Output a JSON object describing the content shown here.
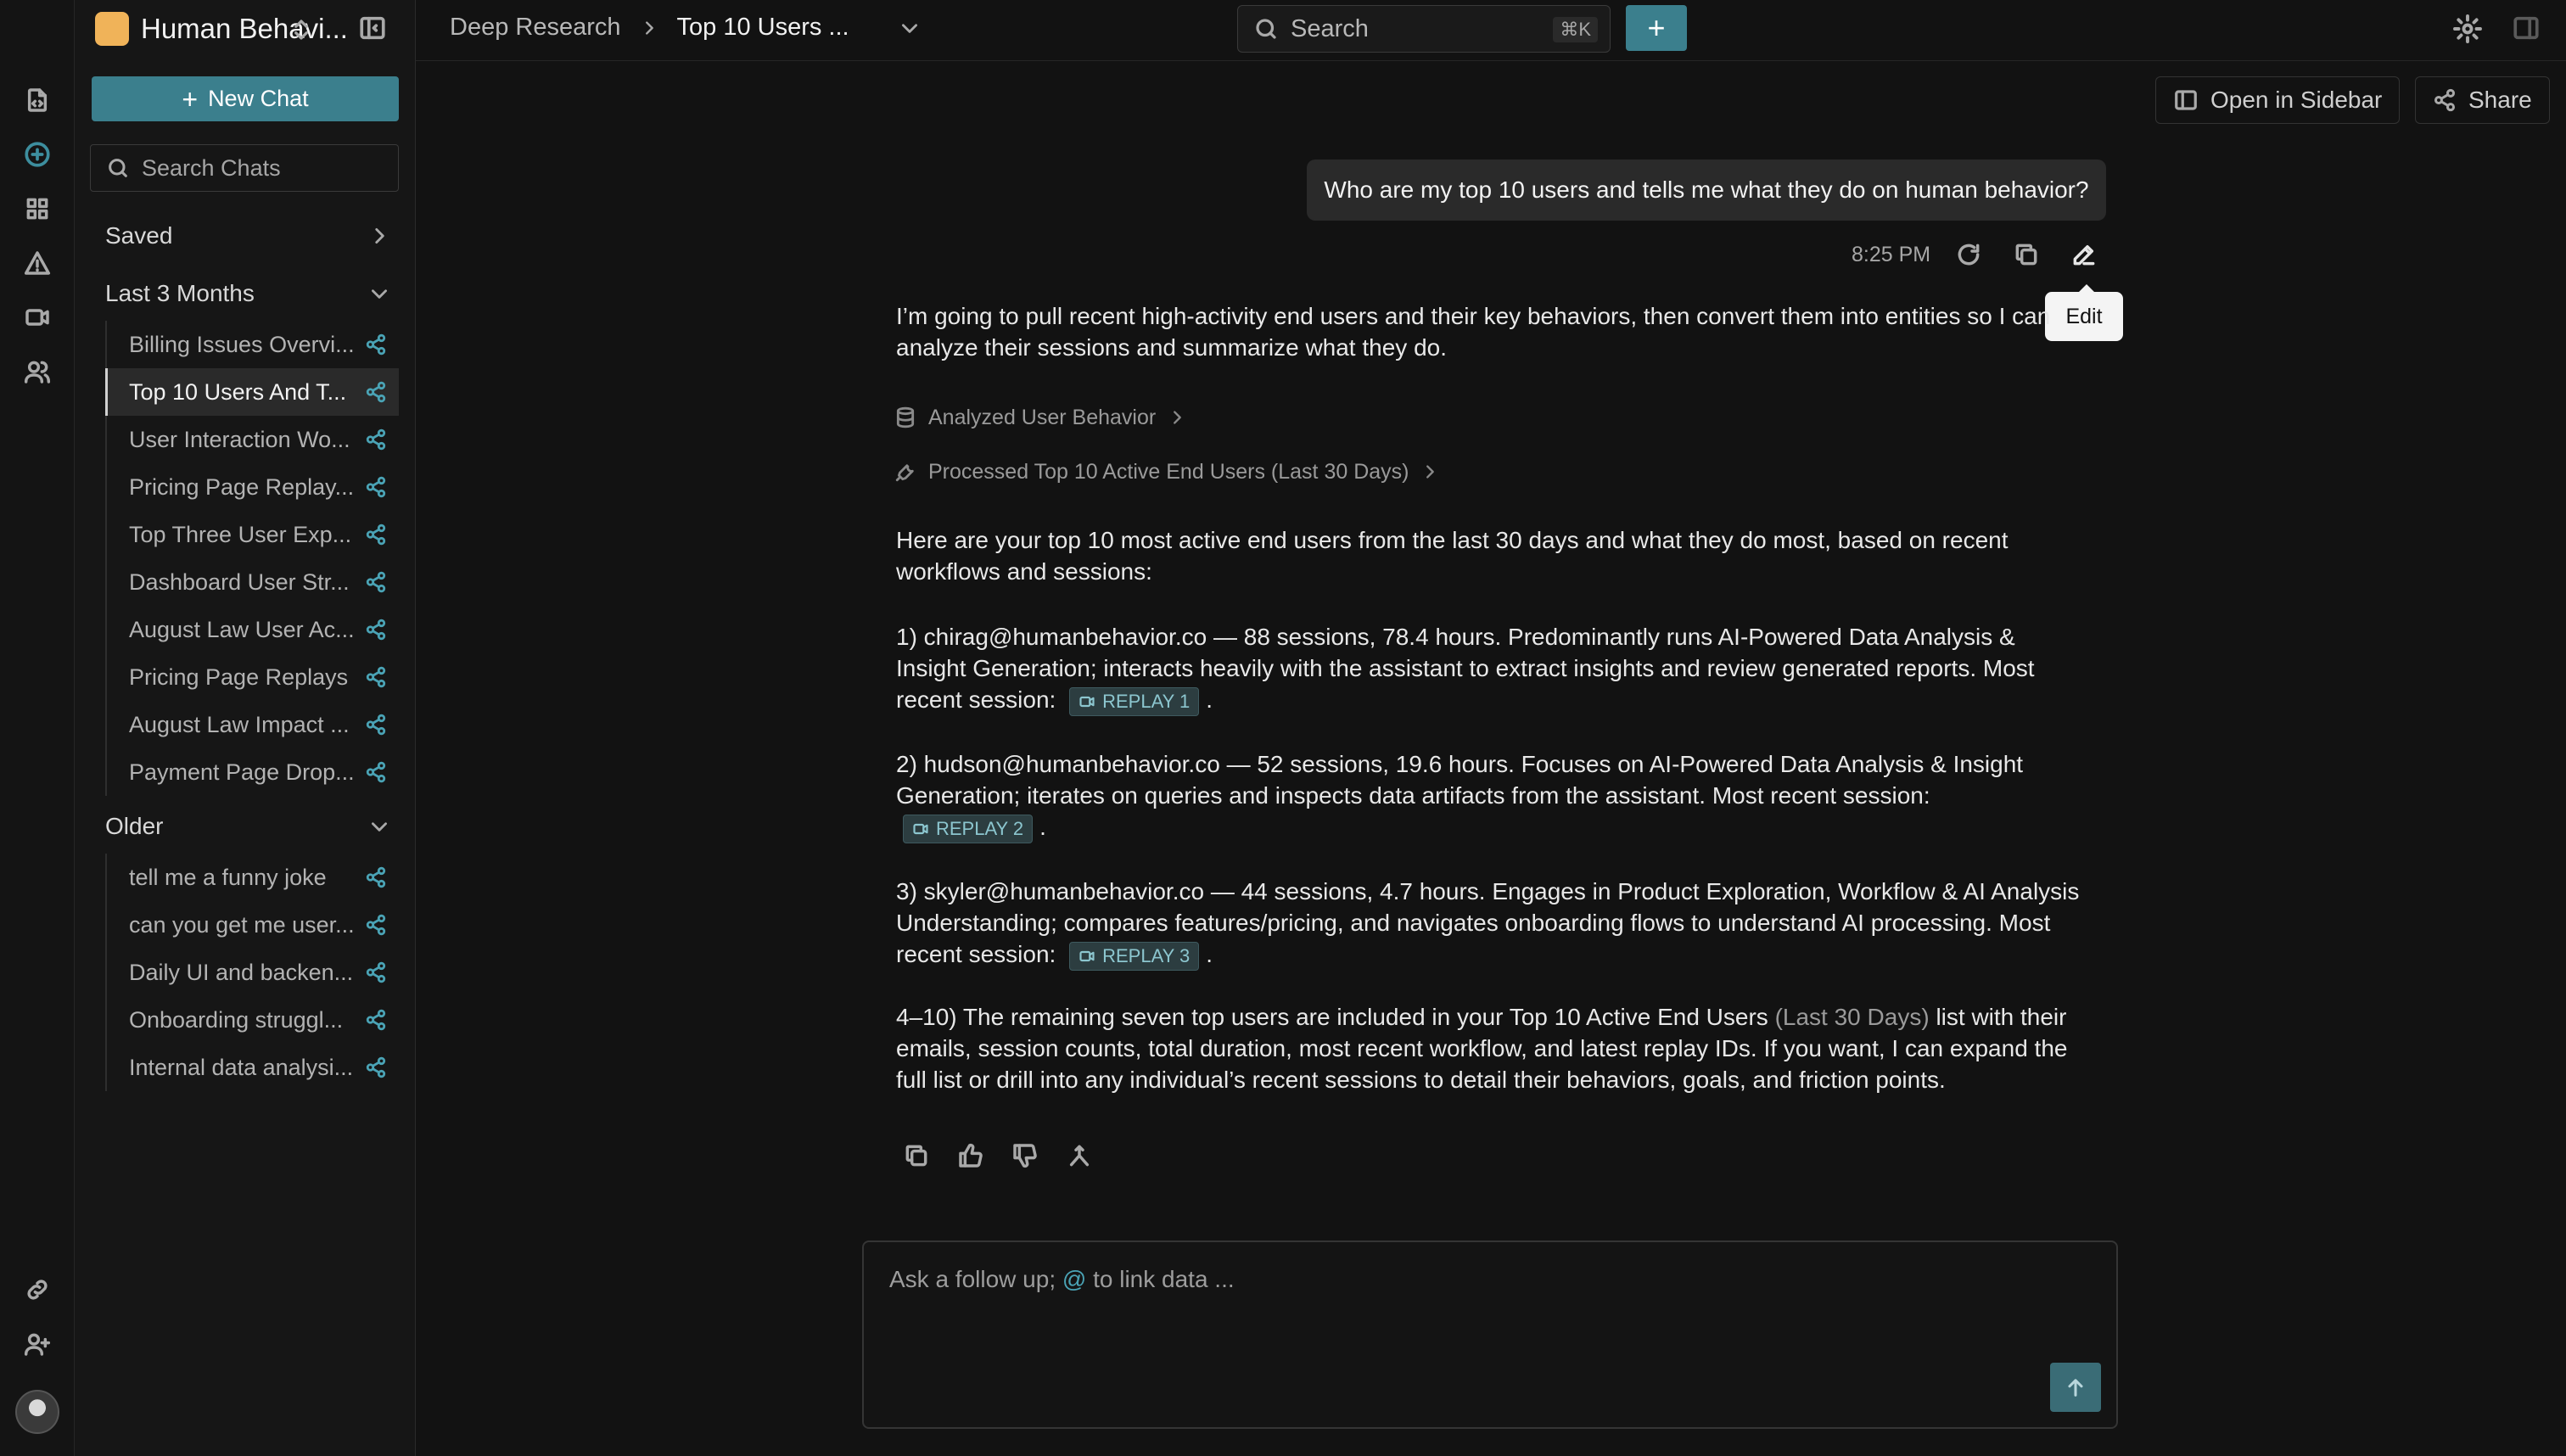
{
  "workspace": {
    "name": "Human Behavi..."
  },
  "new_chat_label": "New Chat",
  "search_chats_placeholder": "Search Chats",
  "sections": {
    "saved": "Saved",
    "last3": "Last 3 Months",
    "older": "Older"
  },
  "chats_last3": [
    "Billing Issues Overvi...",
    "Top 10 Users And T...",
    "User Interaction Wo...",
    "Pricing Page Replay...",
    "Top Three User Exp...",
    "Dashboard User Str...",
    "August Law User Ac...",
    "Pricing Page Replays",
    "August Law Impact ...",
    "Payment Page Drop..."
  ],
  "chats_older": [
    "tell me a funny joke",
    "can you get me user...",
    "Daily UI and backen...",
    "Onboarding struggl...",
    "Internal data analysi..."
  ],
  "breadcrumb": {
    "section": "Deep Research",
    "current": "Top 10 Users ..."
  },
  "search": {
    "label": "Search",
    "shortcut": "⌘K"
  },
  "buttons": {
    "open_sidebar": "Open in Sidebar",
    "share": "Share"
  },
  "user_message": "Who are my top 10 users and tells me what they do on human behavior?",
  "message_time": "8:25 PM",
  "tooltip": "Edit",
  "assistant": {
    "intro": "I’m going to pull recent high-activity end users and their key behaviors, then convert them into entities so I can analyze their sessions and summarize what they do.",
    "tool1": "Analyzed User Behavior",
    "tool2": "Processed Top 10 Active End Users (Last 30 Days)",
    "summary": "Here are your top 10 most active end users from the last 30 days and what they do most, based on recent workflows and sessions:",
    "item1": "1) chirag@humanbehavior.co — 88 sessions, 78.4 hours. Predominantly runs AI-Powered Data Analysis & Insight Generation; interacts heavily with the assistant to extract insights and review generated reports. Most recent session:",
    "item2": "2) hudson@humanbehavior.co — 52 sessions, 19.6 hours. Focuses on AI-Powered Data Analysis & Insight Generation; iterates on queries and inspects data artifacts from the assistant. Most recent session:",
    "item3": "3) skyler@humanbehavior.co — 44 sessions, 4.7 hours. Engages in Product Exploration, Workflow & AI Analysis Understanding; compares features/pricing, and navigates onboarding flows to understand AI processing. Most recent session:",
    "item4_a": "4–10) The remaining seven top users are included in your Top 10 Active End Users",
    "item4_link": "(Last 30 Days)",
    "item4_b": "list with their emails, session counts, total duration, most recent workflow, and latest replay IDs. If you want, I can expand the full list or drill into any individual’s recent sessions to detail their behaviors, goals, and friction points.",
    "replays": [
      "REPLAY 1",
      "REPLAY 2",
      "REPLAY 3"
    ],
    "period": "."
  },
  "composer": {
    "placeholder_a": "Ask a follow up;",
    "placeholder_at": "@",
    "placeholder_b": "to link data ..."
  },
  "colors": {
    "accent": "#3b7f8d",
    "background": "#121212",
    "workspace_logo": "#f0b359"
  }
}
